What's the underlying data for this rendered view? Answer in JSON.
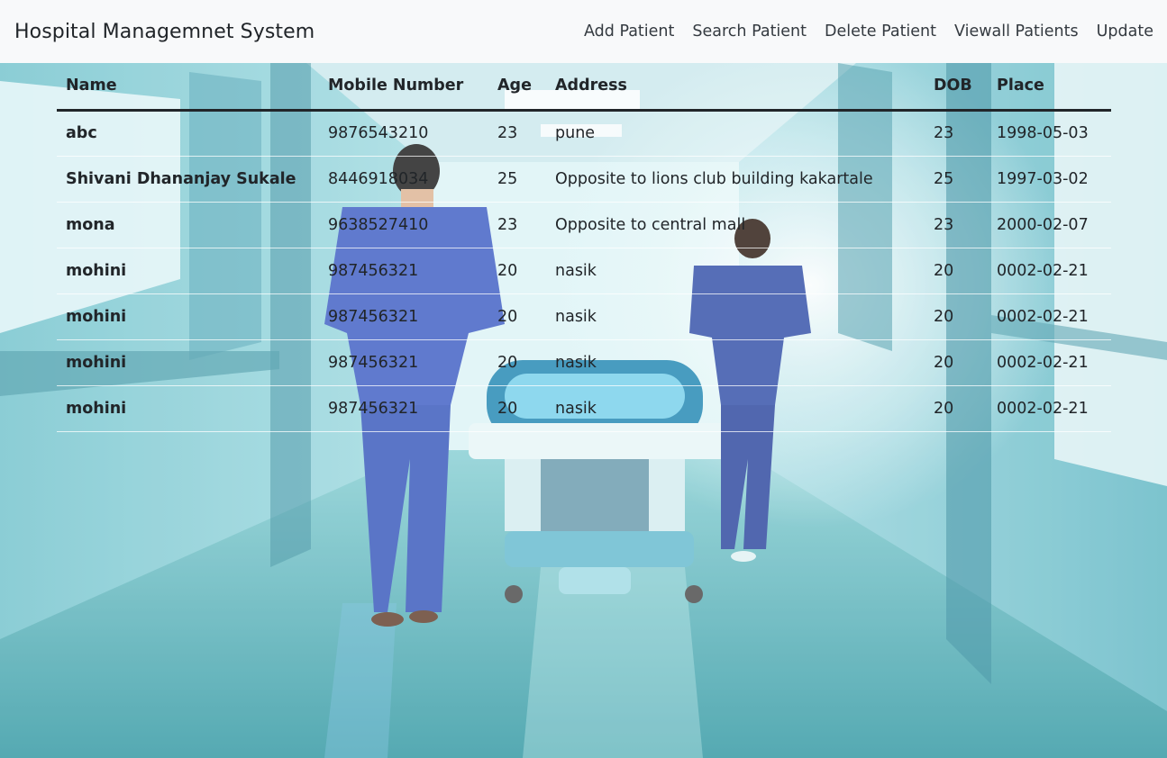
{
  "navbar": {
    "brand": "Hospital Managemnet System",
    "links": [
      "Add Patient",
      "Search Patient",
      "Delete Patient",
      "Viewall Patients",
      "Update"
    ]
  },
  "table": {
    "headers": [
      "Name",
      "Mobile Number",
      "Age",
      "Address",
      "DOB",
      "Place"
    ],
    "rows": [
      [
        "abc",
        "9876543210",
        "23",
        "pune",
        "23",
        "1998-05-03"
      ],
      [
        "Shivani Dhananjay Sukale",
        "8446918034",
        "25",
        "Opposite to lions club building kakartale",
        "25",
        "1997-03-02"
      ],
      [
        "mona",
        "9638527410",
        "23",
        "Opposite to central mall",
        "23",
        "2000-02-07"
      ],
      [
        "mohini",
        "987456321",
        "20",
        "nasik",
        "20",
        "0002-02-21"
      ],
      [
        "mohini",
        "987456321",
        "20",
        "nasik",
        "20",
        "0002-02-21"
      ],
      [
        "mohini",
        "987456321",
        "20",
        "nasik",
        "20",
        "0002-02-21"
      ],
      [
        "mohini",
        "987456321",
        "20",
        "nasik",
        "20",
        "0002-02-21"
      ]
    ]
  },
  "colors": {
    "navbar_bg": "#f8f9fa",
    "text": "#212529",
    "corridor_teal": "#5fb3bf",
    "scrubs_blue": "#4a68c8"
  }
}
